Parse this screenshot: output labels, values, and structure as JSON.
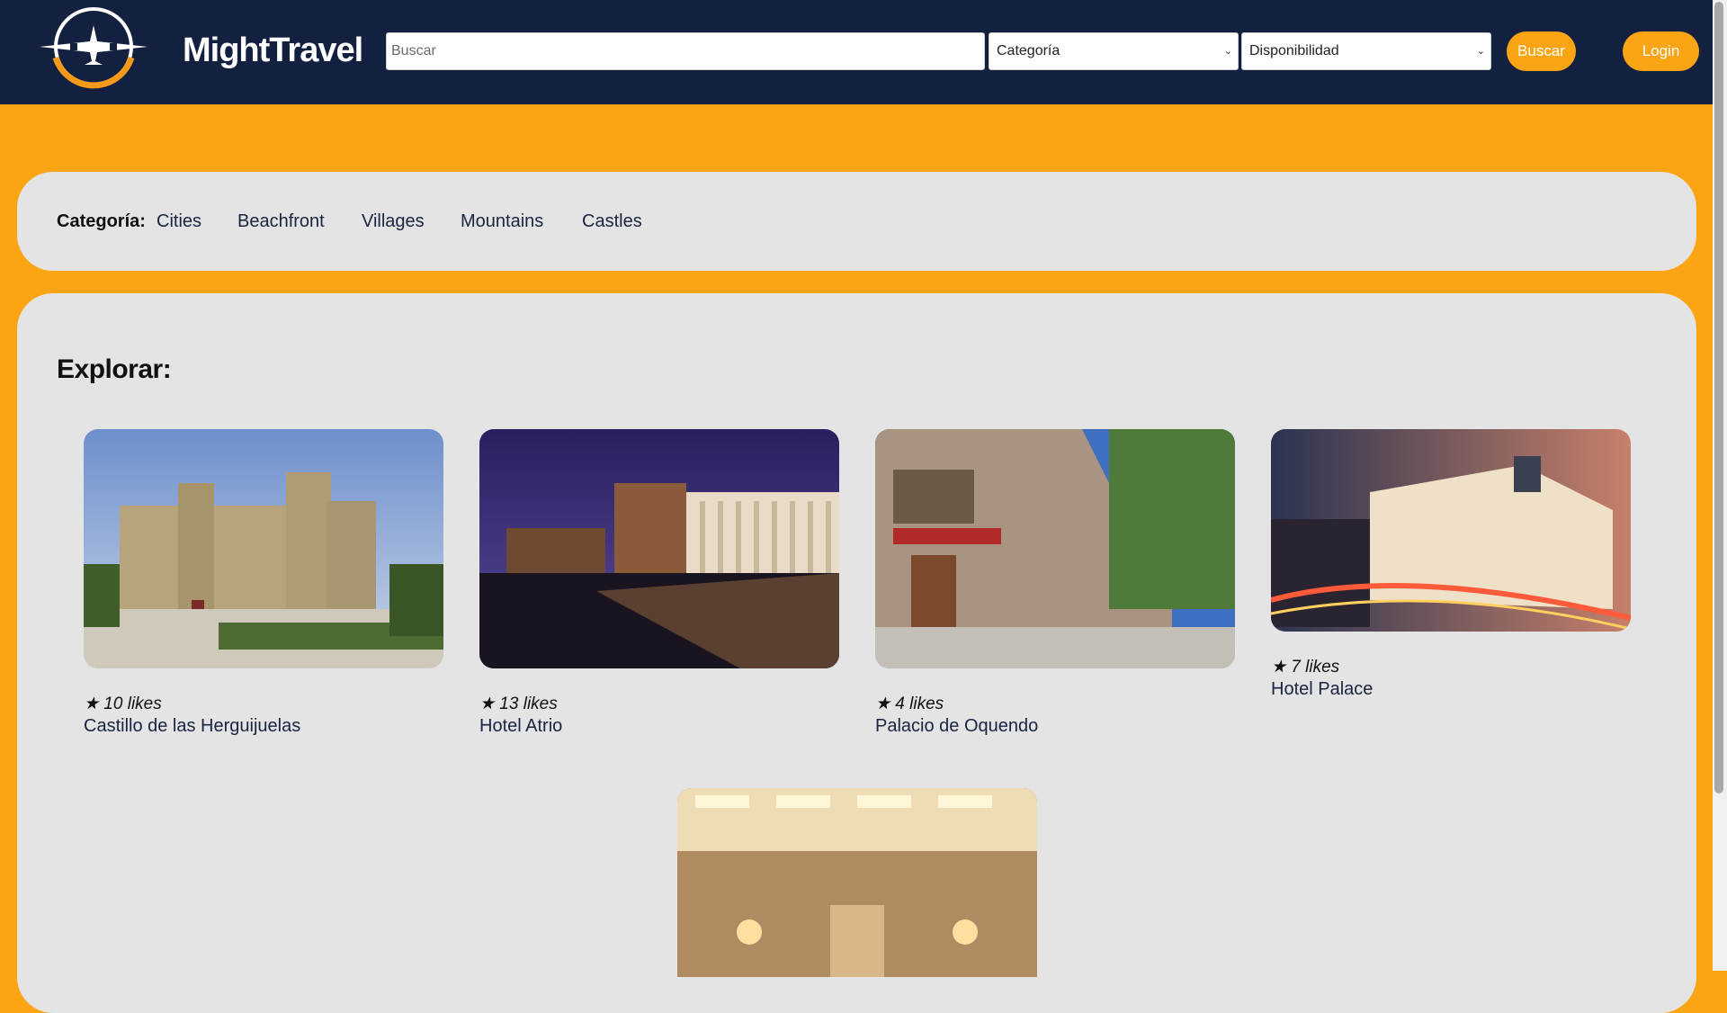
{
  "brand": {
    "name": "MightTravel"
  },
  "search": {
    "placeholder": "Buscar",
    "value": ""
  },
  "filters": {
    "category": "Categoría",
    "availability": "Disponibilidad"
  },
  "buttons": {
    "search": "Buscar",
    "login": "Login"
  },
  "colors": {
    "navbar": "#142040",
    "accent": "#fca514",
    "panel": "#e4e4e4"
  },
  "category_bar": {
    "label": "Categoría:",
    "items": [
      "Cities",
      "Beachfront",
      "Villages",
      "Mountains",
      "Castles"
    ]
  },
  "explore": {
    "title": "Explorar:",
    "cards": [
      {
        "likes": "★ 10 likes",
        "name": "Castillo de las Herguijuelas"
      },
      {
        "likes": "★ 13 likes",
        "name": "Hotel Atrio"
      },
      {
        "likes": "★ 4 likes",
        "name": "Palacio de Oquendo"
      },
      {
        "likes": "★ 7 likes",
        "name": "Hotel Palace"
      },
      {
        "likes": "",
        "name": ""
      }
    ]
  }
}
